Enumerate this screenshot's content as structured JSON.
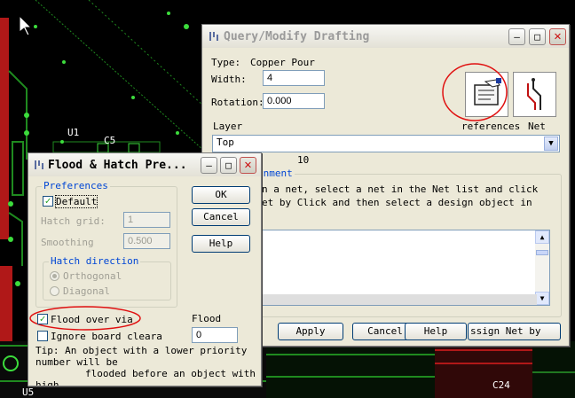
{
  "pcb": {
    "labels": [
      "U1",
      "C5",
      "10",
      "U5",
      "C24"
    ]
  },
  "query_dialog": {
    "title": "Query/Modify Drafting",
    "type_label": "Type:",
    "type_value": "Copper Pour",
    "width_label": "Width:",
    "width_value": "4",
    "rotation_label": "Rotation:",
    "rotation_value": "0.000",
    "preferences_label": "references",
    "net_label": "Net",
    "layer_label": "Layer",
    "layer_value": "Top",
    "net_assignment_title": "gnment",
    "instructions_line1": "n a net, select a net in the Net list and click",
    "instructions_line2": "et by Click and then select a design object in",
    "buttons": {
      "apply": "Apply",
      "cancel": "Cancel",
      "help": "Help",
      "assign": "ssign Net by Clic"
    }
  },
  "flood_dialog": {
    "title": "Flood & Hatch Pre...",
    "preferences_group": "Preferences",
    "default_label": "Default",
    "hatch_grid_label": "Hatch grid:",
    "hatch_grid_value": "1",
    "smoothing_label": "Smoothing",
    "smoothing_value": "0.500",
    "hatch_direction_group": "Hatch direction",
    "orthogonal_label": "Orthogonal",
    "diagonal_label": "Diagonal",
    "ok": "OK",
    "cancel": "Cancel",
    "help": "Help",
    "flood_over_via_label": "Flood over via",
    "flood_label": "Flood",
    "ignore_board_label": "Ignore board cleara",
    "flood_value": "0",
    "tip_line1": "Tip: An object with a lower priority",
    "tip_line2": "number will be",
    "tip_line3": "flooded before an object with a",
    "tip_line4": "high"
  },
  "colors": {
    "pcb_background": "#000000",
    "trace_green": "#1f8a1f",
    "trace_red": "#b01818",
    "via_green": "#3cdc3c",
    "annotation_red": "#e01010",
    "dialog_bg": "#ece9d8",
    "group_title_blue": "#0046d5"
  }
}
